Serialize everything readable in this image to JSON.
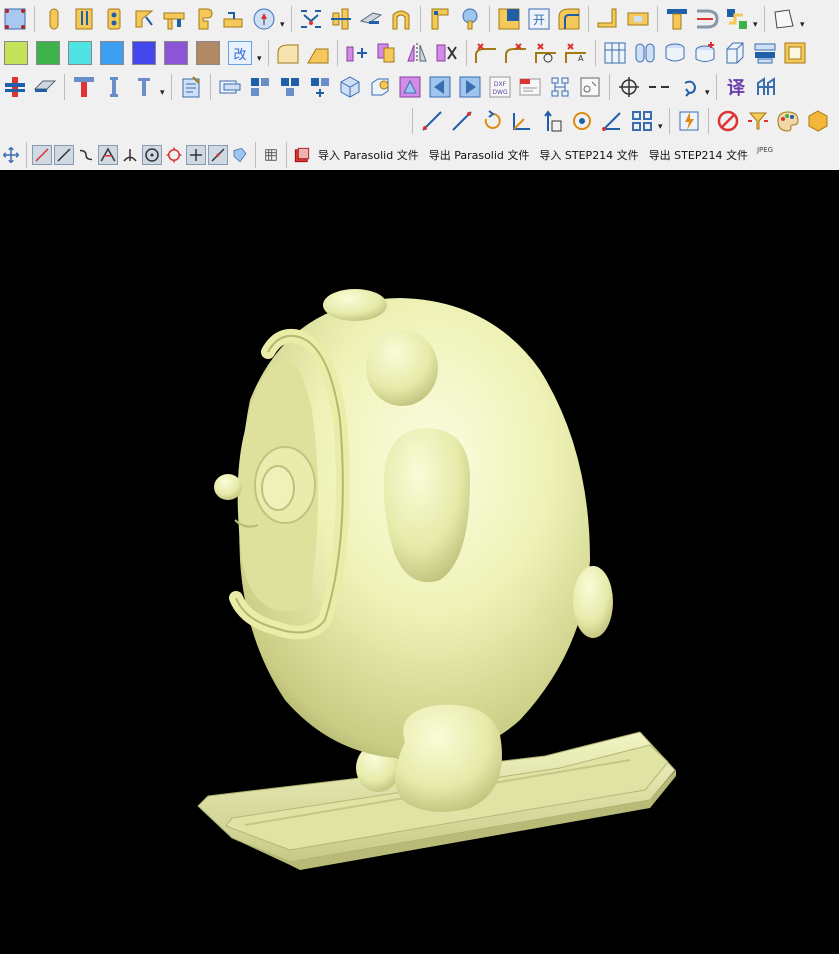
{
  "toolbar": {
    "row1": {
      "icons": [
        "edge-box-icon",
        "slot-icon",
        "double-slot-icon",
        "plate-holes-icon",
        "angle-bend-icon",
        "pipe-fitting-icon",
        "hook-icon",
        "bracket-icon",
        "dimension-icon",
        "plane-flip-icon",
        "cross-join-icon",
        "rail-icon",
        "arch-icon",
        "corner-plate-icon",
        "pin-icon",
        "corner-fill-icon",
        "kai-panel-icon",
        "rounded-corner-icon",
        "l-corner-icon",
        "block-icon",
        "t-beam-icon",
        "d-shape-icon",
        "n-shape-icon",
        "plane-view-icon"
      ]
    },
    "row2": {
      "colors": [
        "#c4e35a",
        "#3fb14a",
        "#4fe3e3",
        "#3e9ff0",
        "#4447ec",
        "#8a55d6",
        "#b08a64"
      ],
      "gai_label": "改",
      "icons": [
        "curve-face-icon",
        "slope-face-icon",
        "move-faces-icon",
        "layered-sheets-icon",
        "mirror-icon",
        "x-faces-icon",
        "fillet-x-icon",
        "fillet-x2-icon",
        "fillet-circle-icon",
        "fillet-a-icon",
        "grid-panel-icon",
        "tube-pair-icon",
        "drum-icon",
        "drum-plus-icon",
        "box-outline-icon",
        "stack-icon",
        "frame-plane-icon"
      ]
    },
    "row3": {
      "icons": [
        "beam-icon",
        "hinge-icon",
        "t-bar-icon",
        "i-bar-icon",
        "t-small-icon",
        "notebook-icon",
        "panel-slide-icon",
        "blocks-step-icon",
        "blocks-grid-icon",
        "blocks-move-icon",
        "cube-icon",
        "cube-edit-icon",
        "face-edit-icon",
        "triangle-left-icon",
        "triangle-right-icon",
        "dxf-dwg-icon",
        "new-doc-icon",
        "network-icon",
        "shape-swap-icon",
        "target-icon",
        "dashes-icon",
        "undo-arrow-icon",
        "translate-icon",
        "link-icon"
      ],
      "translate_label": "译"
    },
    "row4": {
      "icons": [
        "line-3d-icon",
        "line-point-icon",
        "rotate-arc-icon",
        "axis-bend-icon",
        "axis-up-icon",
        "rotate-circle-icon",
        "axis-corner-icon",
        "grid-snap-icon",
        "lightning-icon",
        "no-entry-icon",
        "light-icon",
        "palette-icon",
        "cube-gold-icon"
      ]
    },
    "row5": {
      "icons": [
        "move-icon",
        "line-diag-icon",
        "line-diag2-icon",
        "curve-tilde-icon",
        "angle-snap-icon",
        "perpendicular-icon",
        "circle-center-icon",
        "circle-icon",
        "cross-icon",
        "line-tilt-icon",
        "shield-icon",
        "layers-icon",
        "box-red-icon"
      ],
      "import_parasolid": "导入 Parasolid 文件",
      "export_parasolid": "导出 Parasolid 文件",
      "import_step": "导入 STEP214 文件",
      "export_step": "导出 STEP214 文件",
      "jpeg_label": "JPEG"
    }
  },
  "viewport": {
    "background": "#000000",
    "model_color": "#eef2b6",
    "model_icon": "3d-character-on-skis"
  }
}
